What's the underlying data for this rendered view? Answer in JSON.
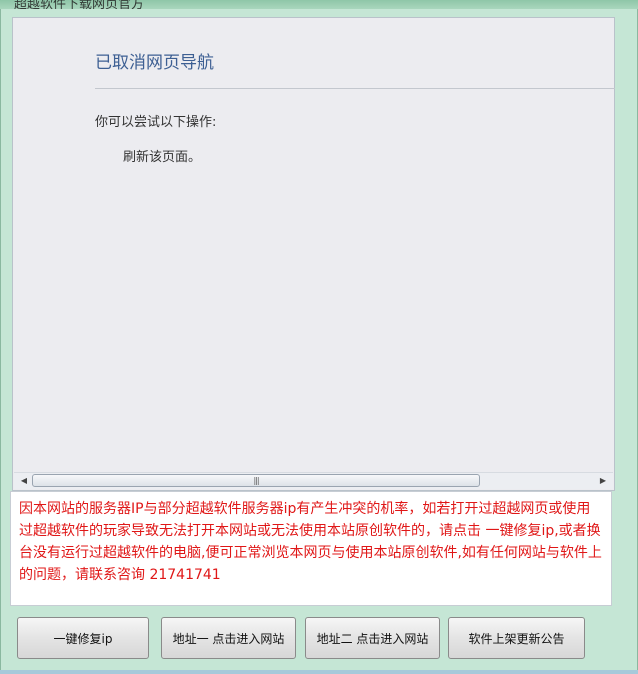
{
  "window": {
    "title": "超越软件下载网页官方"
  },
  "browser": {
    "error_title": "已取消网页导航",
    "subtitle": "你可以尝试以下操作:",
    "suggestion": "刷新该页面。",
    "scrollbar": {
      "left_arrow": "◀",
      "right_arrow": "▶",
      "grip": "|||"
    }
  },
  "notice": {
    "text": "因本网站的服务器IP与部分超越软件服务器ip有产生冲突的机率，如若打开过超越网页或使用过超越软件的玩家导致无法打开本网站或无法使用本站原创软件的，请点击 一键修复ip,或者换台没有运行过超越软件的电脑,便可正常浏览本网页与使用本站原创软件,如有任何网站与软件上的问题，请联系咨询 21741741",
    "color": "#e01717"
  },
  "buttons": [
    {
      "label": "一键修复ip"
    },
    {
      "label": "地址一 点击进入网站"
    },
    {
      "label": "地址二 点击进入网站"
    },
    {
      "label": "软件上架更新公告"
    }
  ]
}
